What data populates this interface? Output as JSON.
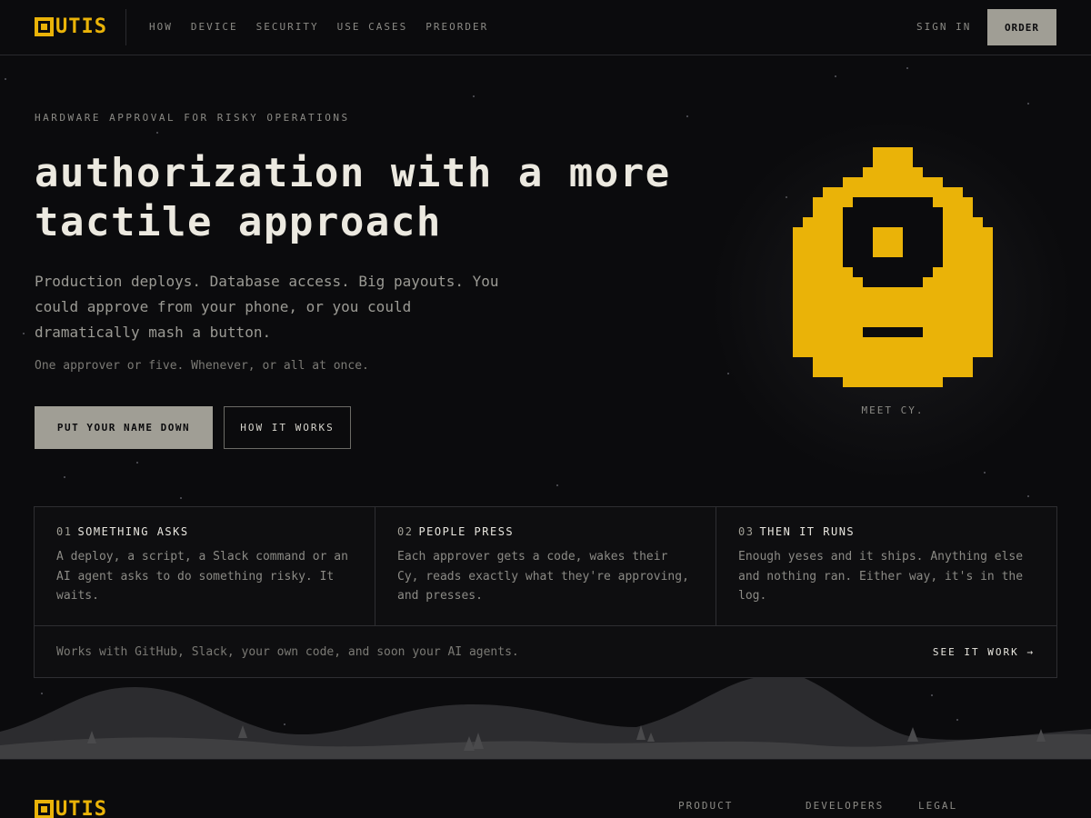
{
  "brand": {
    "logo_text": "UTIS",
    "accent": "#eab308"
  },
  "nav": {
    "links": [
      "HOW",
      "DEVICE",
      "SECURITY",
      "USE CASES",
      "PREORDER"
    ],
    "sign_in": "SIGN IN",
    "order": "ORDER"
  },
  "hero": {
    "eyebrow": "HARDWARE APPROVAL FOR RISKY OPERATIONS",
    "title_line1": "authorization with a more",
    "title_line2": "tactile approach",
    "lead": "Production deploys. Database access. Big payouts. You could approve from your phone, or you could dramatically mash a button.",
    "note": "One approver or five. Whenever, or all at once.",
    "primary_button": "PUT YOUR NAME DOWN",
    "secondary_button": "HOW IT WORKS",
    "mascot_caption": "MEET CY."
  },
  "steps": [
    {
      "num": "01",
      "title": "SOMETHING ASKS",
      "body": "A deploy, a script, a Slack command or an AI agent asks to do something risky. It waits."
    },
    {
      "num": "02",
      "title": "PEOPLE PRESS",
      "body": "Each approver gets a code, wakes their Cy, reads exactly what they're approving, and presses."
    },
    {
      "num": "03",
      "title": "THEN IT RUNS",
      "body": "Enough yeses and it ships. Anything else and nothing ran. Either way, it's in the log."
    }
  ],
  "steps_footer": {
    "text": "Works with GitHub, Slack, your own code, and soon your AI agents.",
    "link": "SEE IT WORK →"
  },
  "footer": {
    "columns": [
      "PRODUCT",
      "DEVELOPERS",
      "LEGAL"
    ]
  }
}
